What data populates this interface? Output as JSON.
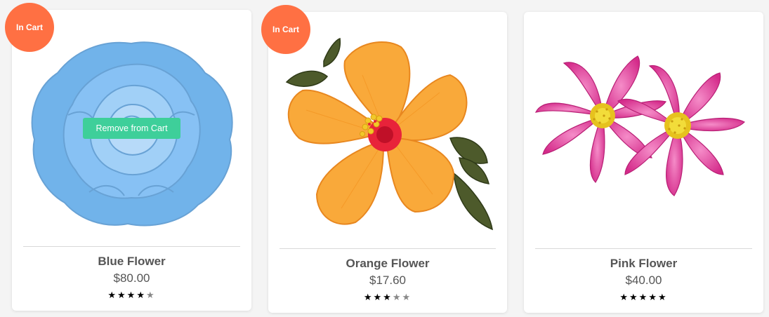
{
  "products": [
    {
      "name": "Blue Flower",
      "price": "$80.00",
      "rating": 4,
      "rating_max": 5,
      "in_cart": true,
      "badge_label": "In Cart",
      "action_label": "Remove from Cart",
      "image": "blue-rose",
      "image_faded": true
    },
    {
      "name": "Orange Flower",
      "price": "$17.60",
      "rating": 3,
      "rating_max": 5,
      "in_cart": true,
      "badge_label": "In Cart",
      "image": "orange-hibiscus",
      "image_faded": false
    },
    {
      "name": "Pink Flower",
      "price": "$40.00",
      "rating": 5,
      "rating_max": 5,
      "in_cart": false,
      "image": "pink-cosmos",
      "image_faded": false
    }
  ],
  "colors": {
    "badge": "#ff7043",
    "action_button": "#3ecf9a",
    "star_filled": "#000000",
    "star_empty": "#888888"
  }
}
